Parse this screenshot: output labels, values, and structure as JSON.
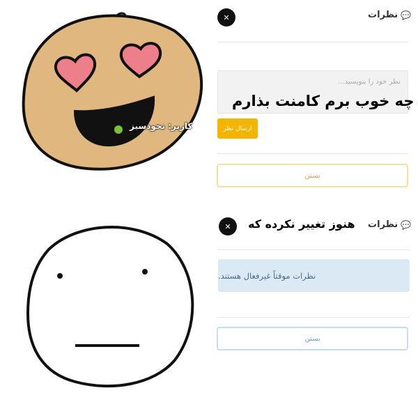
{
  "top_panel": {
    "title": "نظرات",
    "comment_placeholder": "نظر خود را بنویسید...",
    "overlay_text": "عه چه خوب برم کامنت بذارم",
    "send_button": "ارسال نظر",
    "close_button": "بستن",
    "watermark": "کاربر: نخودسبز",
    "accent_color": "#f5b400"
  },
  "bottom_panel": {
    "title": "نظرات",
    "overlay_text": "هنوز تغییر نکرده که",
    "notice": "نظرات موقتاً غیرفعال هستند.",
    "close_button": "بستن",
    "notice_color": "#dbe9f5"
  },
  "icons": {
    "comment": "speech-bubble-icon",
    "close": "close-icon"
  }
}
